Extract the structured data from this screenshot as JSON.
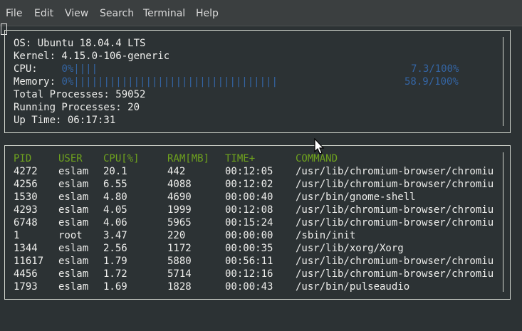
{
  "menu": [
    "File",
    "Edit",
    "View",
    "Search",
    "Terminal",
    "Help"
  ],
  "system": {
    "os": "OS: Ubuntu 18.04.4 LTS",
    "kernel": "Kernel: 4.15.0-106-generic",
    "cpu_label": "CPU:    ",
    "cpu_bar": "0%||||",
    "cpu_value": "7.3/100%",
    "mem_label": "Memory: ",
    "mem_bar": "0%||||||||||||||||||||||||||||||||||",
    "mem_value": "58.9/100%",
    "total_processes": "Total Processes: 59052",
    "running_processes": "Running Processes: 20",
    "up_time": "Up Time: 06:17:31"
  },
  "processes": {
    "columns": [
      "PID",
      "USER",
      "CPU[%]",
      "RAM[MB]",
      "TIME+",
      "COMMAND"
    ],
    "rows": [
      [
        "4272",
        "eslam",
        "20.1",
        "442",
        "00:12:05",
        "/usr/lib/chromium-browser/chromiu"
      ],
      [
        "4256",
        "eslam",
        "6.55",
        "4088",
        "00:12:02",
        "/usr/lib/chromium-browser/chromiu"
      ],
      [
        "1530",
        "eslam",
        "4.80",
        "4690",
        "00:00:40",
        "/usr/bin/gnome-shell"
      ],
      [
        "4293",
        "eslam",
        "4.05",
        "1999",
        "00:12:08",
        "/usr/lib/chromium-browser/chromiu"
      ],
      [
        "6748",
        "eslam",
        "4.06",
        "5965",
        "00:15:24",
        "/usr/lib/chromium-browser/chromiu"
      ],
      [
        "1",
        "root",
        "3.47",
        "220",
        "00:00:00",
        "/sbin/init"
      ],
      [
        "1344",
        "eslam",
        "2.56",
        "1172",
        "00:00:35",
        "/usr/lib/xorg/Xorg"
      ],
      [
        "11617",
        "eslam",
        "1.79",
        "5880",
        "00:56:11",
        "/usr/lib/chromium-browser/chromiu"
      ],
      [
        "4456",
        "eslam",
        "1.72",
        "5714",
        "00:12:16",
        "/usr/lib/chromium-browser/chromiu"
      ],
      [
        "1793",
        "eslam",
        "1.69",
        "1828",
        "00:00:43",
        "/usr/bin/pulseaudio"
      ]
    ]
  },
  "colors": {
    "accent_green": "#6fa31e",
    "bar_blue": "#3465a4"
  },
  "icons": [
    "mouse-pointer-icon"
  ]
}
